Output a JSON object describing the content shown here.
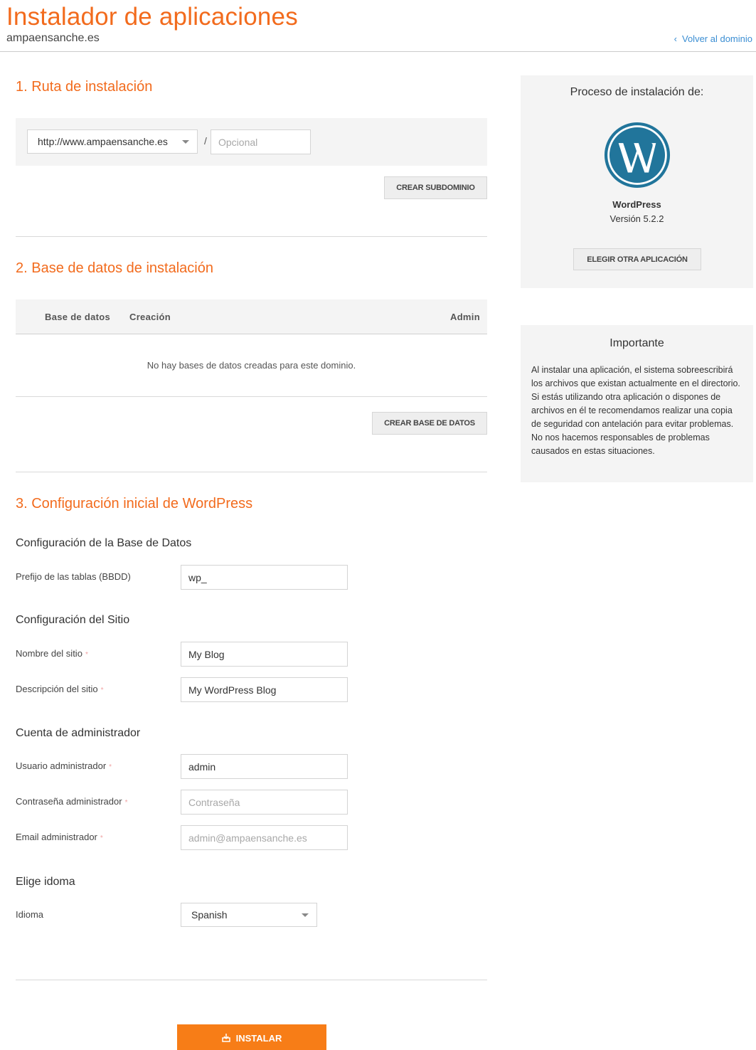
{
  "header": {
    "title": "Instalador de aplicaciones",
    "domain": "ampaensanche.es",
    "back_link": "Volver al dominio"
  },
  "section1": {
    "title": "1. Ruta de instalación",
    "url_select_value": "http://www.ampaensanche.es",
    "separator": "/",
    "path_placeholder": "Opcional",
    "create_subdomain_button": "CREAR SUBDOMINIO"
  },
  "section2": {
    "title": "2. Base de datos de instalación",
    "columns": [
      "Base de datos",
      "Creación",
      "Admin"
    ],
    "empty_message": "No hay bases de datos creadas para este dominio.",
    "create_db_button": "CREAR BASE DE DATOS"
  },
  "section3": {
    "title": "3. Configuración inicial de WordPress",
    "db_config": {
      "heading": "Configuración de la Base de Datos",
      "prefix_label": "Prefijo de las tablas (BBDD)",
      "prefix_value": "wp_"
    },
    "site_config": {
      "heading": "Configuración del Sitio",
      "name_label": "Nombre del sitio",
      "name_value": "My Blog",
      "description_label": "Descripción del sitio",
      "description_value": "My WordPress Blog"
    },
    "admin_account": {
      "heading": "Cuenta de administrador",
      "user_label": "Usuario administrador",
      "user_value": "admin",
      "password_label": "Contraseña administrador",
      "password_placeholder": "Contraseña",
      "email_label": "Email administrador",
      "email_placeholder": "admin@ampaensanche.es"
    },
    "language": {
      "heading": "Elige idoma",
      "label": "Idioma",
      "value": "Spanish"
    },
    "required_marker": "*",
    "install_button": "INSTALAR"
  },
  "sidebar": {
    "process_title": "Proceso de instalación de:",
    "app_name": "WordPress",
    "app_version": "Versión 5.2.2",
    "choose_other_button": "ELEGIR OTRA APLICACIÓN",
    "important_title": "Importante",
    "important_text": "Al instalar una aplicación, el sistema sobreescribirá los archivos que existan actualmente en el directorio. Si estás utilizando otra aplicación o dispones de archivos en él te recomendamos realizar una copia de seguridad con antelación para evitar problemas. No nos hacemos responsables de problemas causados en estas situaciones."
  },
  "colors": {
    "accent": "#f26b1d",
    "install_button": "#f77d17",
    "link": "#3b8ed3",
    "wordpress_blue": "#21759b"
  },
  "icons": {
    "back": "chevron-left-icon",
    "wordpress": "wordpress-logo",
    "install": "install-icon"
  }
}
